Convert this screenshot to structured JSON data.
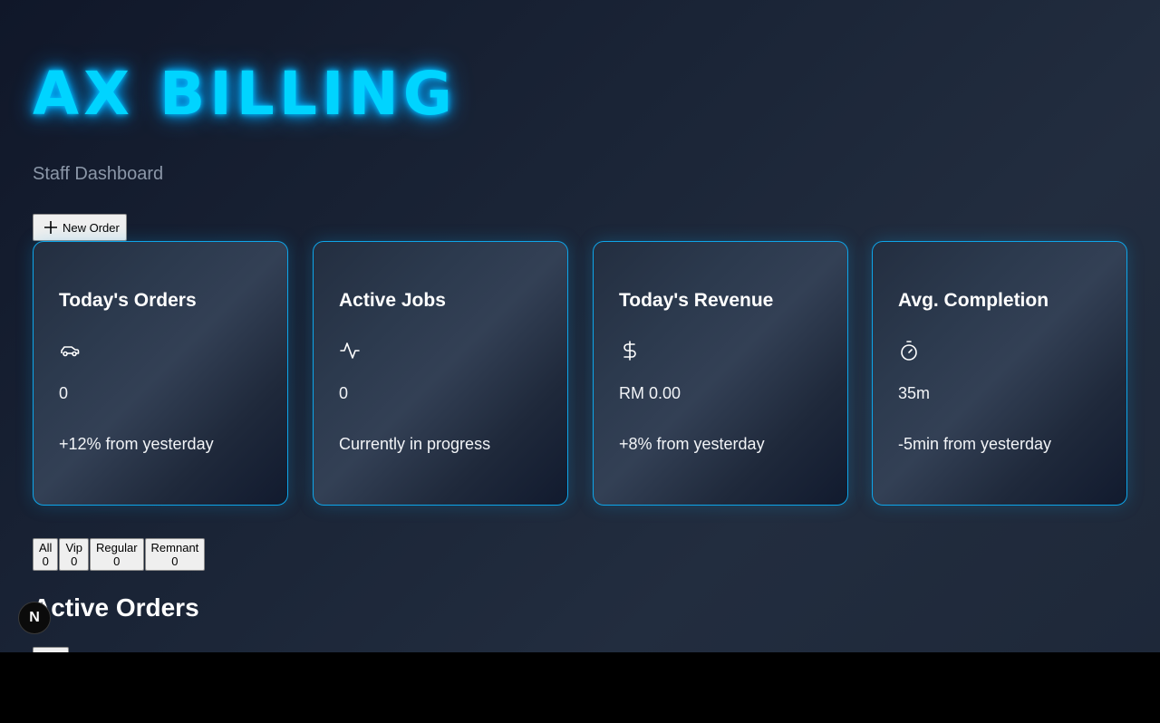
{
  "header": {
    "title": "AX BILLING",
    "subtitle": "Staff Dashboard"
  },
  "toolbar": {
    "new_order_label": "New Order",
    "new_order_icon": "plus-icon"
  },
  "stats": [
    {
      "title": "Today's Orders",
      "icon": "car-icon",
      "value": "0",
      "note": "+12% from yesterday"
    },
    {
      "title": "Active Jobs",
      "icon": "activity-icon",
      "value": "0",
      "note": "Currently in progress"
    },
    {
      "title": "Today's Revenue",
      "icon": "dollar-icon",
      "value": "RM 0.00",
      "note": "+8% from yesterday"
    },
    {
      "title": "Avg. Completion",
      "icon": "timer-icon",
      "value": "35m",
      "note": "-5min from yesterday"
    }
  ],
  "filters": [
    {
      "label": "All",
      "count": "0"
    },
    {
      "label": "Vip",
      "count": "0"
    },
    {
      "label": "Regular",
      "count": "0"
    },
    {
      "label": "Remnant",
      "count": "0"
    }
  ],
  "orders": {
    "title": "Active Orders",
    "add_icon": "plus-icon"
  },
  "dev_badge": {
    "label": "N"
  },
  "colors": {
    "accent": "#00d4ff",
    "card_border": "#0ea5e9",
    "background": "#1a2436"
  }
}
